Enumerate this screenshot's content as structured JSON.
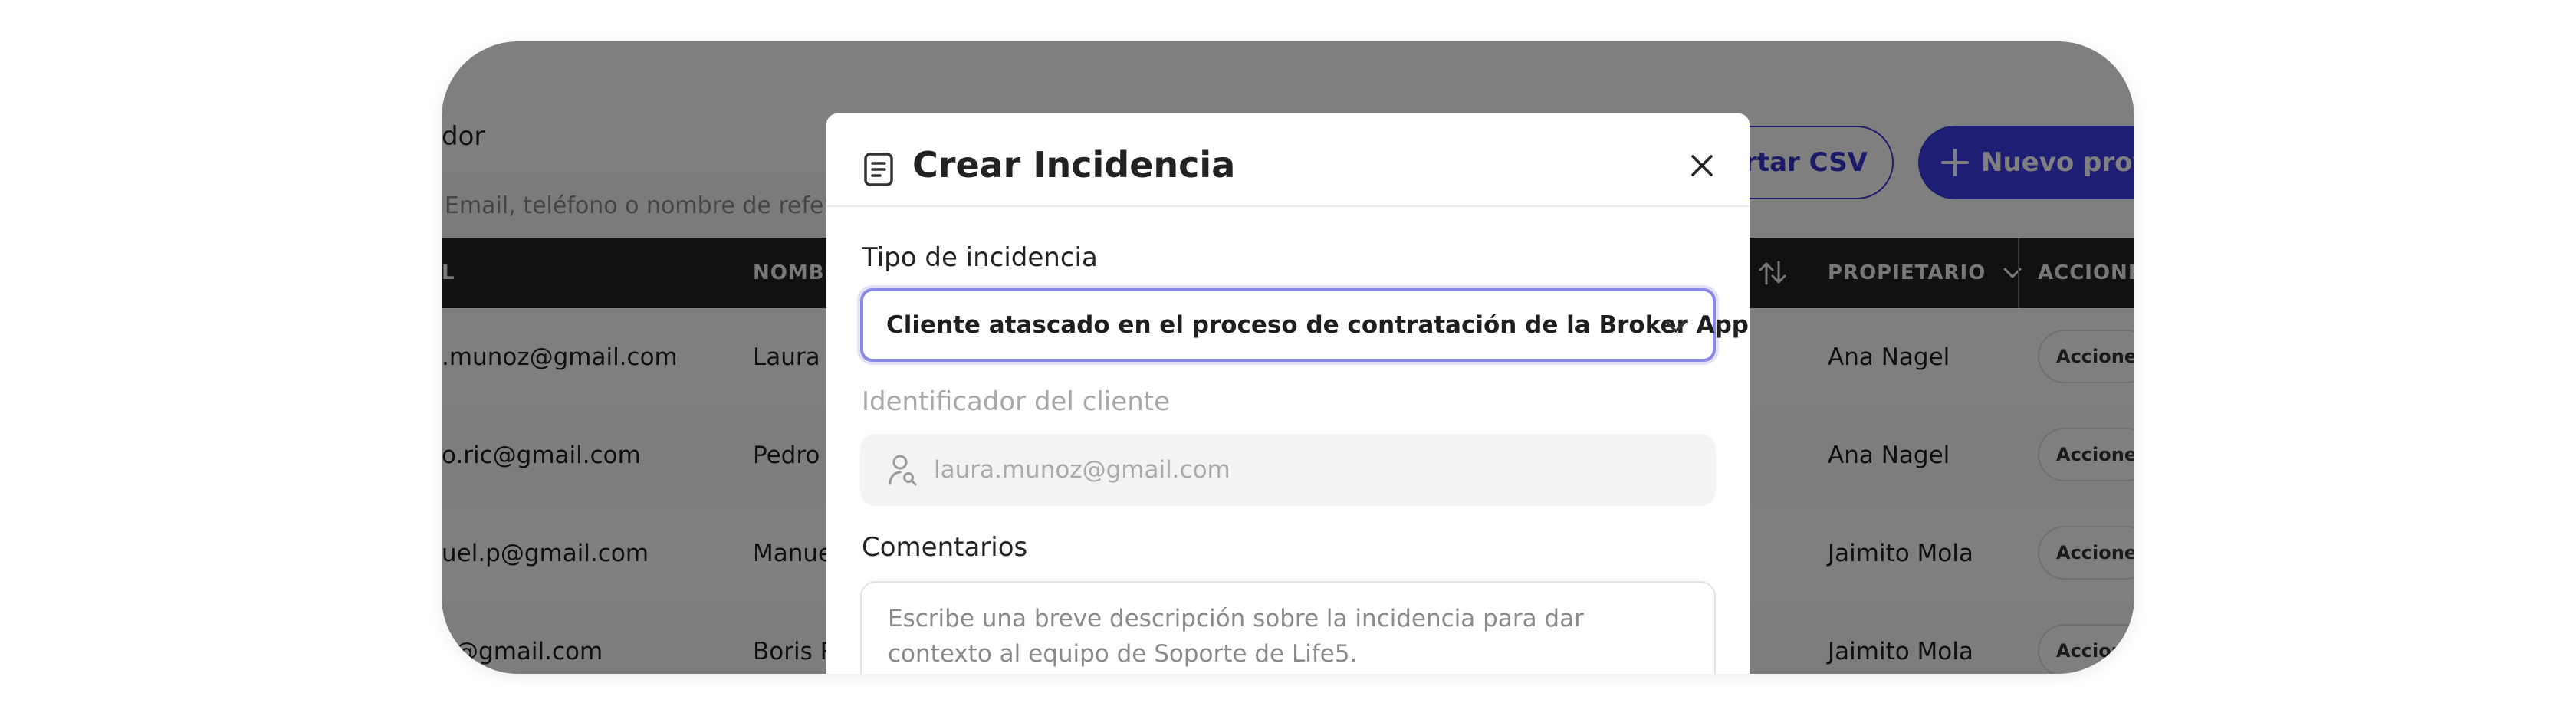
{
  "background": {
    "title_fragment": "dor",
    "search_placeholder": "Email, teléfono o nombre de referencia",
    "export_button": "ortar CSV",
    "new_project_button": "Nuevo proye",
    "columns": {
      "email": "L",
      "name": "NOMBRE",
      "owner": "PROPIETARIO",
      "actions": "ACCIONES"
    },
    "rows": [
      {
        "email": ".munoz@gmail.com",
        "name": "Laura M",
        "owner": "Ana Nagel",
        "action": "Acciones"
      },
      {
        "email": "o.ric@gmail.com",
        "name": "Pedro R",
        "owner": "Ana Nagel",
        "action": "Acciones"
      },
      {
        "email": "uel.p@gmail.com",
        "name": "Manuel",
        "owner": "Jaimito Mola",
        "action": "Acciones"
      },
      {
        "email": "c@gmail.com",
        "name": "Boris R",
        "owner": "Jaimito Mola",
        "action": "Acciones"
      }
    ]
  },
  "modal": {
    "title": "Crear Incidencia",
    "type_label": "Tipo de incidencia",
    "type_value": "Cliente atascado en el proceso de contratación de la Broker App",
    "client_id_label": "Identificador del cliente",
    "client_id_value": "laura.munoz@gmail.com",
    "comments_label": "Comentarios",
    "comments_placeholder": "Escribe una breve descripción sobre la incidencia para dar contexto al equipo de Soporte de Life5."
  },
  "colors": {
    "accent": "#3c3ce8",
    "table_header": "#222222",
    "select_focus": "#8a8ae6"
  }
}
